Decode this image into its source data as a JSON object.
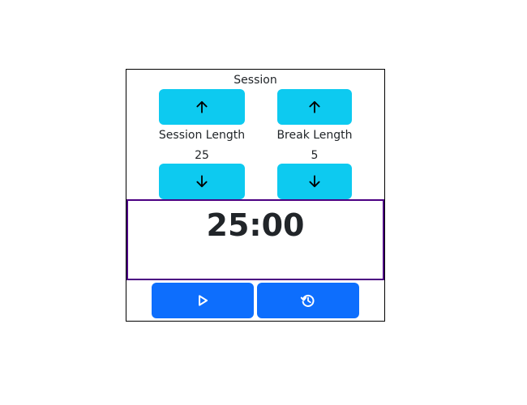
{
  "timer": {
    "label": "Session",
    "time_left": "25:00"
  },
  "session": {
    "label": "Session Length",
    "value": "25",
    "increment_icon": "arrow-up-icon",
    "decrement_icon": "arrow-down-icon"
  },
  "break": {
    "label": "Break Length",
    "value": "5",
    "increment_icon": "arrow-up-icon",
    "decrement_icon": "arrow-down-icon"
  },
  "controls": {
    "start_stop_icon": "play-icon",
    "reset_icon": "restore-icon"
  },
  "colors": {
    "adjust_button": "#0dcaf0",
    "control_button": "#0d6efd",
    "display_border": "#4b0082",
    "text": "#212529"
  }
}
